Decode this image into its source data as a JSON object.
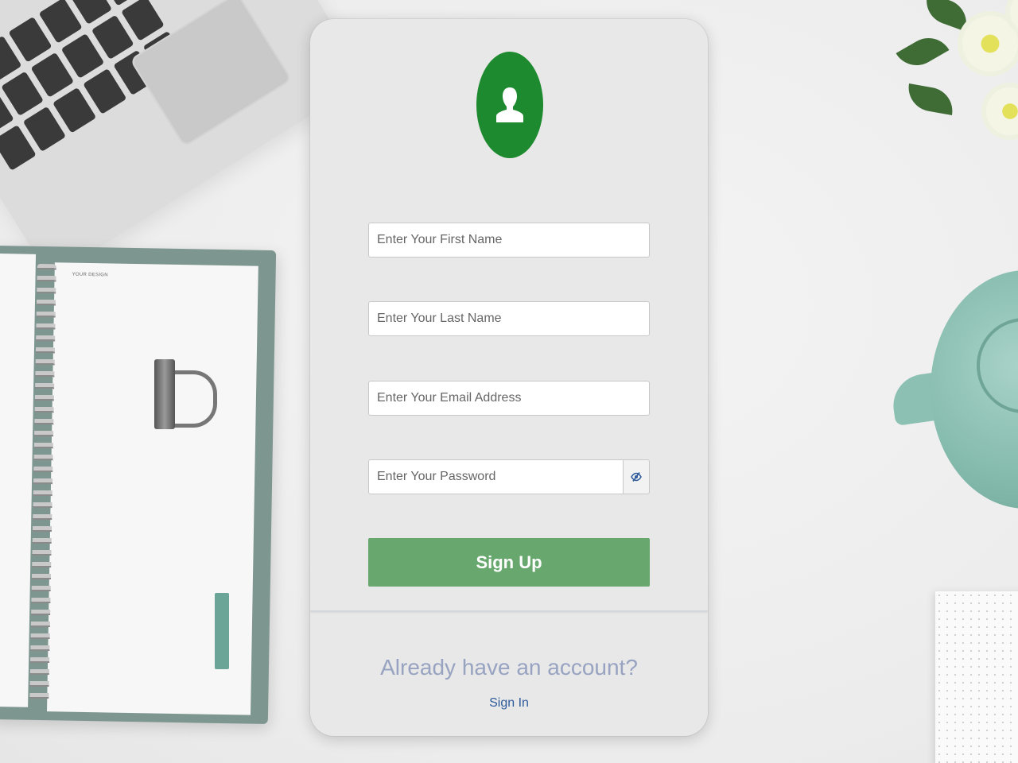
{
  "colors": {
    "avatar_bg": "#1e8a2f",
    "button_bg": "#68a86e",
    "footer_question": "#97a3c1",
    "link": "#2d5b9b"
  },
  "form": {
    "avatar_icon": "user-icon",
    "first_name_placeholder": "Enter Your First Name",
    "last_name_placeholder": "Enter Your Last Name",
    "email_placeholder": "Enter Your Email Address",
    "password_placeholder": "Enter Your Password",
    "password_toggle_icon": "eye-slash-icon",
    "submit_label": "Sign Up"
  },
  "footer": {
    "question": "Already have an account?",
    "signin_label": "Sign In"
  },
  "background": {
    "notebook_label": "YOUR DESIGN"
  }
}
